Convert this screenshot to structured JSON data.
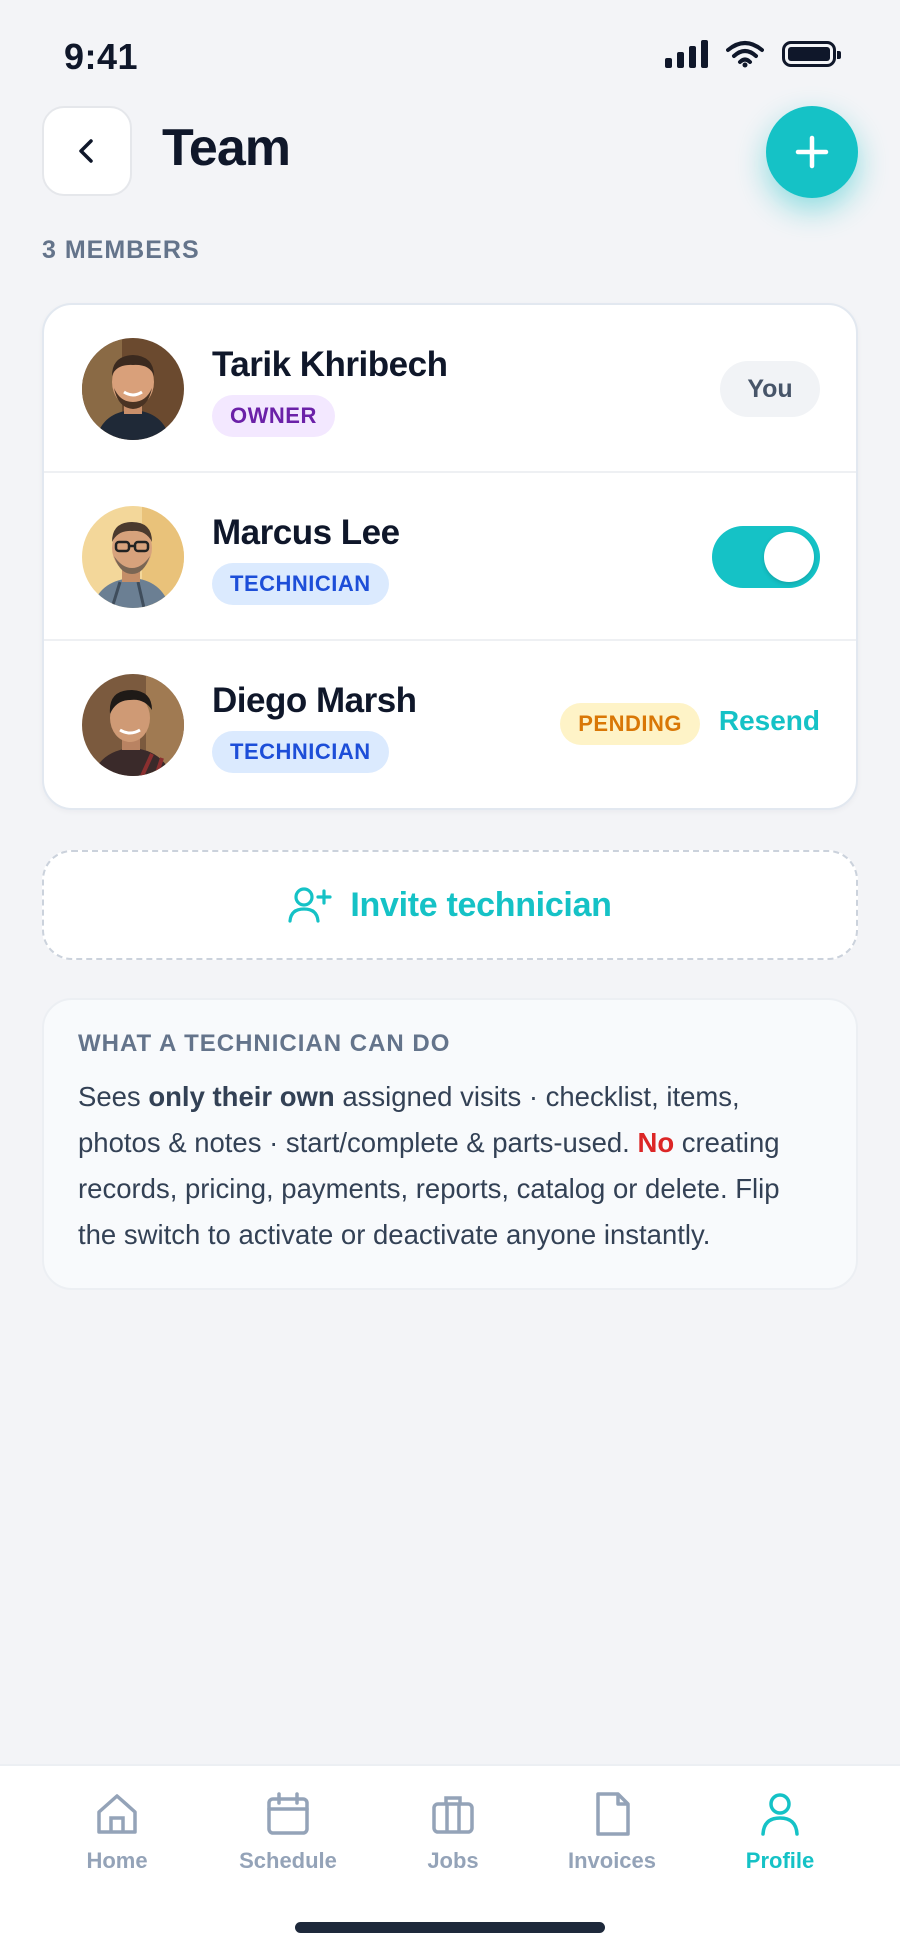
{
  "status_bar": {
    "time": "9:41"
  },
  "header": {
    "title": "Team"
  },
  "members_count": "3 MEMBERS",
  "members": [
    {
      "name": "Tarik Khribech",
      "role": "OWNER",
      "status": "You"
    },
    {
      "name": "Marcus Lee",
      "role": "TECHNICIAN",
      "active": true
    },
    {
      "name": "Diego Marsh",
      "role": "TECHNICIAN",
      "status": "PENDING",
      "action": "Resend"
    }
  ],
  "invite": {
    "label": "Invite technician"
  },
  "info": {
    "title": "WHAT A TECHNICIAN CAN DO",
    "text_1": "Sees ",
    "bold_1": "only their own",
    "text_2": " assigned visits · checklist, items, photos & notes · start/complete & parts-used. ",
    "no": "No",
    "text_3": " creating records, pricing, payments, reports, catalog or delete. Flip the switch to activate or deactivate anyone instantly."
  },
  "tabbar": [
    {
      "label": "Home",
      "icon": "home-icon"
    },
    {
      "label": "Schedule",
      "icon": "calendar-icon"
    },
    {
      "label": "Jobs",
      "icon": "briefcase-icon"
    },
    {
      "label": "Invoices",
      "icon": "document-icon"
    },
    {
      "label": "Profile",
      "icon": "user-icon",
      "active": true
    }
  ],
  "colors": {
    "accent": "#15c2c6",
    "owner_badge_bg": "#f3e8ff",
    "tech_badge_bg": "#dbeafe",
    "pending_badge_bg": "#fef3c7",
    "danger": "#dc2626"
  }
}
